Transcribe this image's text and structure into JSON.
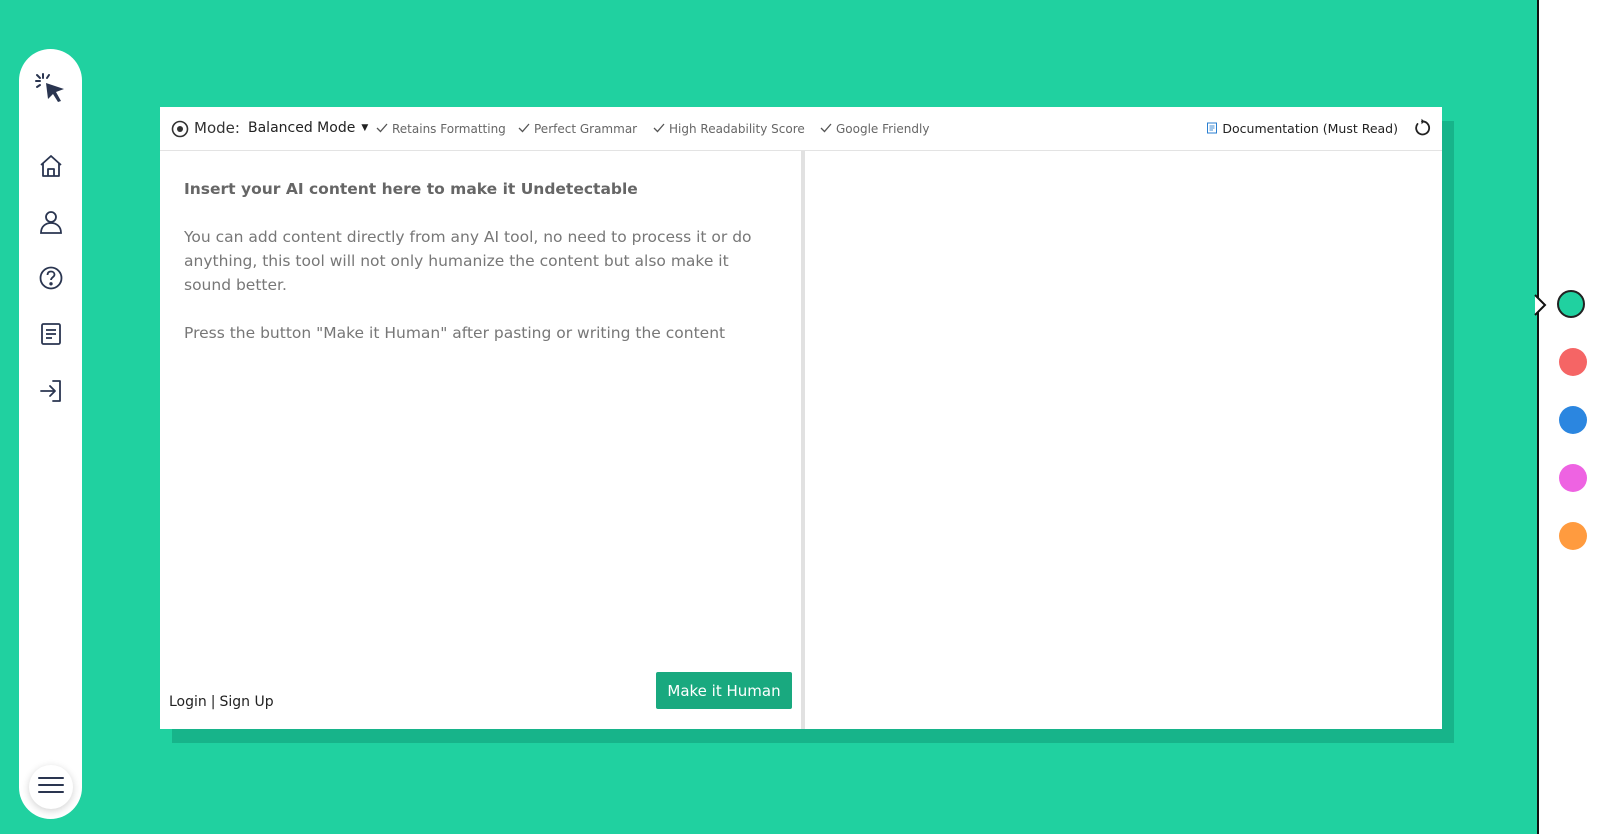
{
  "sidebar": {
    "icons": [
      "cursor-click-logo",
      "home-icon",
      "user-icon",
      "help-icon",
      "document-icon",
      "login-icon",
      "menu-icon"
    ]
  },
  "toolbar": {
    "mode_label": "Mode:",
    "mode_value": "Balanced Mode",
    "features": [
      "Retains Formatting",
      "Perfect Grammar",
      "High Readability Score",
      "Google Friendly"
    ],
    "doc_link": "Documentation (Must Read)"
  },
  "editor": {
    "placeholder_title": "Insert your AI content here to make it Undetectable",
    "placeholder_body": "You can add content directly from any AI tool, no need to process it or do anything, this tool will not only humanize the content but also make it sound better.",
    "placeholder_hint": "Press the button \"Make it Human\" after pasting or writing the content"
  },
  "footer": {
    "login": "Login",
    "separator": "|",
    "signup": "Sign Up",
    "submit_label": "Make it Human"
  },
  "theme_colors": [
    "#20d1a0",
    "#f56565",
    "#2b86e0",
    "#ee63e2",
    "#ff9b3f"
  ],
  "accent": "#20d1a0"
}
